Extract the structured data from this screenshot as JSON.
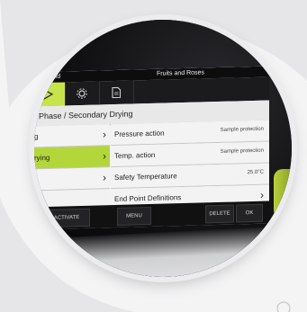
{
  "device": {
    "topbar": {
      "left_text": "load",
      "right_text": "Fruits and Roses"
    },
    "tabs": [
      {
        "name": "tab-start",
        "icon": "play-icon"
      },
      {
        "name": "tab-settings",
        "icon": "gear-icon"
      },
      {
        "name": "tab-document",
        "icon": "document-icon"
      }
    ],
    "breadcrumb": "/ Phase / Secondary Drying",
    "left_rows": [
      {
        "label": "g"
      },
      {
        "label": "rying",
        "selected": true
      },
      {
        "label": ""
      }
    ],
    "right_rows": [
      {
        "label": "Pressure action",
        "value": "Sample protection"
      },
      {
        "label": "Temp. action",
        "value": "Sample protection"
      },
      {
        "label": "Safety Temperature",
        "value": "25.0°C"
      },
      {
        "label": "End Point Definitions",
        "value": ""
      }
    ],
    "buttons": {
      "activate": "ACTIVATE",
      "menu": "MENU",
      "delete": "DELETE",
      "ok": "OK"
    }
  },
  "colors": {
    "accent": "#b3d63a",
    "background": "#f4f4f5"
  }
}
